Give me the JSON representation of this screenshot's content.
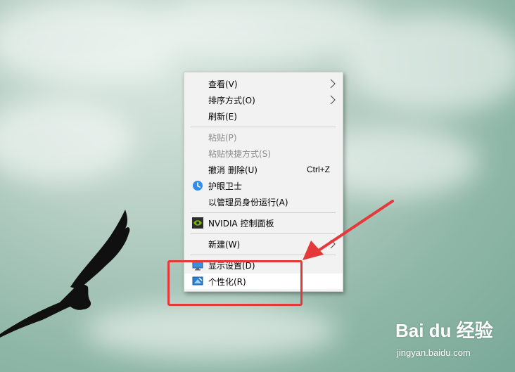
{
  "desktop": {
    "background_colors": [
      "#d8e6df",
      "#8fb7a7"
    ]
  },
  "context_menu": {
    "items": [
      {
        "label": "查看(V)",
        "enabled": true,
        "submenu": true
      },
      {
        "label": "排序方式(O)",
        "enabled": true,
        "submenu": true
      },
      {
        "label": "刷新(E)",
        "enabled": true
      },
      {
        "label": "粘贴(P)",
        "enabled": false
      },
      {
        "label": "粘贴快捷方式(S)",
        "enabled": false
      },
      {
        "label": "撤消 删除(U)",
        "enabled": true,
        "shortcut": "Ctrl+Z"
      },
      {
        "label": "护眼卫士",
        "enabled": true,
        "icon": "clock-icon"
      },
      {
        "label": "以管理员身份运行(A)",
        "enabled": true
      },
      {
        "label": "NVIDIA 控制面板",
        "enabled": true,
        "icon": "nvidia-icon"
      },
      {
        "label": "新建(W)",
        "enabled": true,
        "submenu": true
      },
      {
        "label": "显示设置(D)",
        "enabled": true,
        "icon": "display-icon"
      },
      {
        "label": "个性化(R)",
        "enabled": true,
        "icon": "personalize-icon",
        "highlighted": true
      }
    ]
  },
  "annotation": {
    "color": "#e53939"
  },
  "watermark": {
    "logo": "Bai du 经验",
    "url": "jingyan.baidu.com"
  }
}
